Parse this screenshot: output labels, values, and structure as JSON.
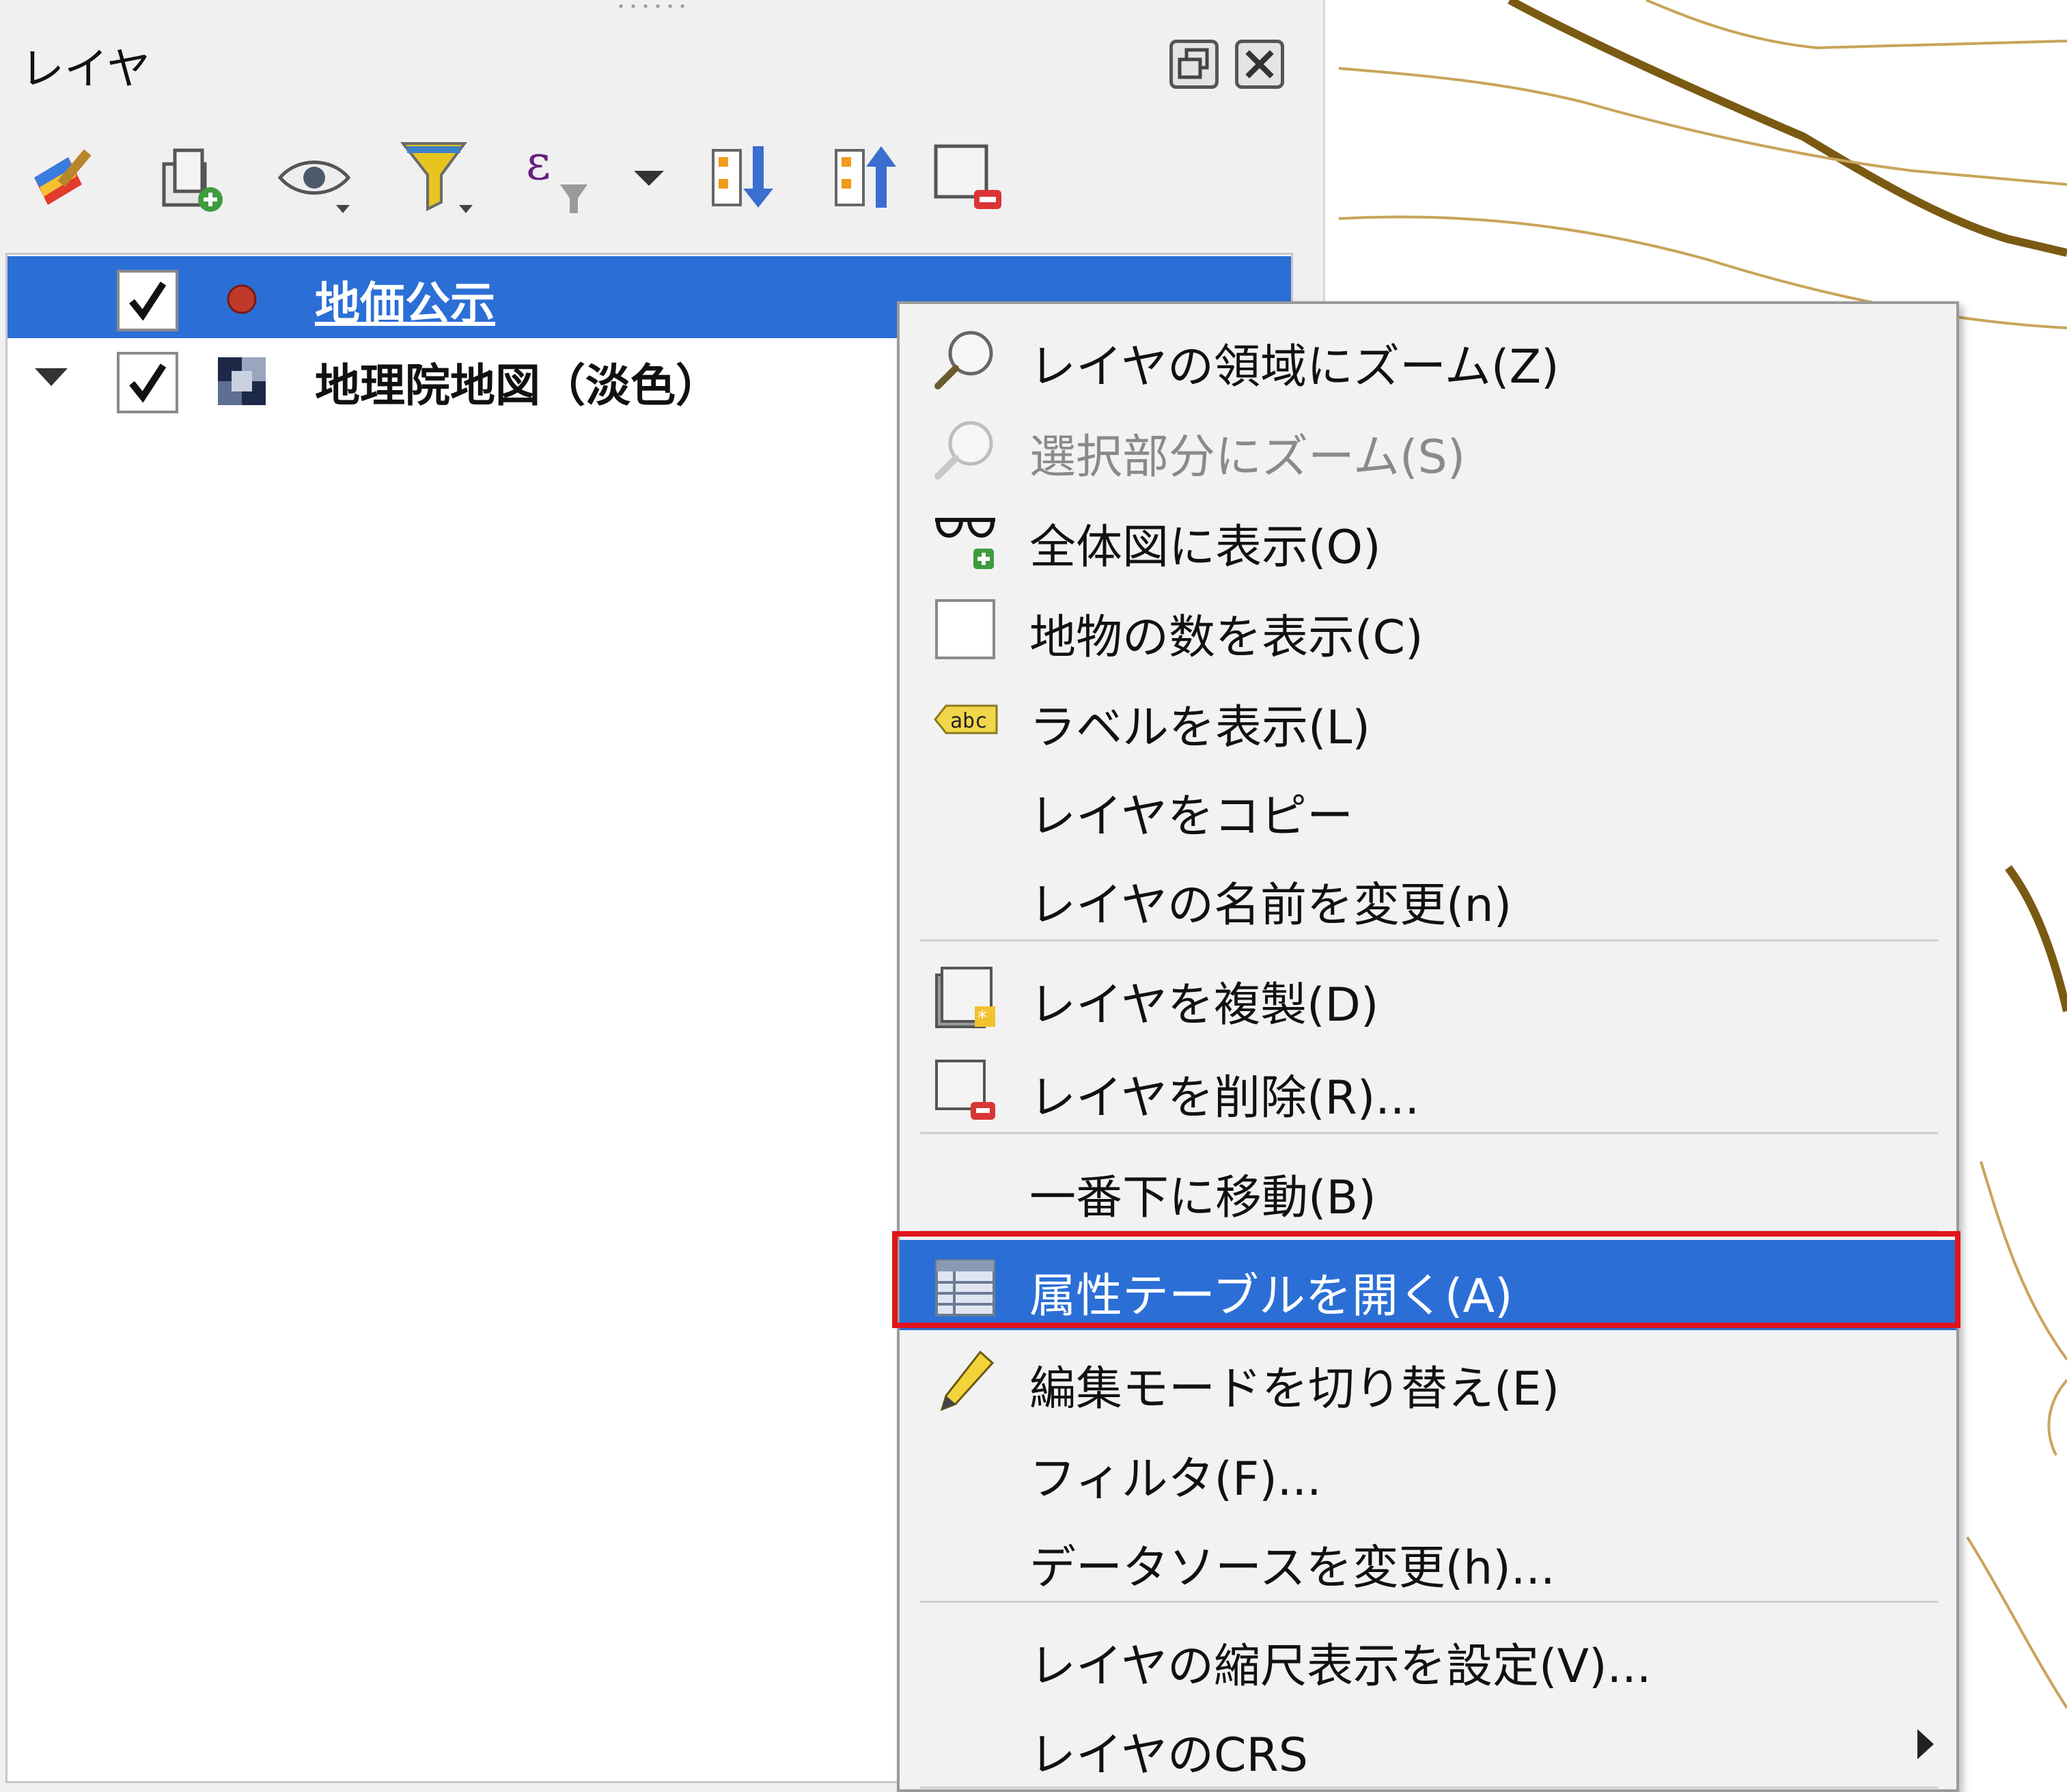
{
  "panel": {
    "title": "レイヤ",
    "toolbar": [
      {
        "icon": "layer-style-brush-icon"
      },
      {
        "icon": "add-group-icon"
      },
      {
        "icon": "visibility-eye-icon"
      },
      {
        "icon": "filter-funnel-icon"
      },
      {
        "icon": "expression-filter-icon"
      },
      {
        "icon": "expand-all-icon"
      },
      {
        "icon": "collapse-all-icon"
      },
      {
        "icon": "remove-layer-icon"
      }
    ]
  },
  "tree": {
    "layers": [
      {
        "name": "地価公示",
        "checked": true,
        "selected": true,
        "icon": "point-layer-icon"
      },
      {
        "name": "地理院地図（淡色）",
        "checked": true,
        "selected": false,
        "icon": "raster-layer-icon"
      }
    ]
  },
  "menu": {
    "items": [
      {
        "label": "レイヤの領域にズーム(Z)",
        "icon": "zoom-layer-icon"
      },
      {
        "label": "選択部分にズーム(S)",
        "icon": "zoom-selection-icon",
        "disabled": true
      },
      {
        "label": "全体図に表示(O)",
        "icon": "overview-glasses-icon"
      },
      {
        "label": "地物の数を表示(C)",
        "icon": "checkbox-icon"
      },
      {
        "label": "ラベルを表示(L)",
        "icon": "label-abc-icon",
        "icon_text": "abc"
      },
      {
        "label": "レイヤをコピー"
      },
      {
        "label": "レイヤの名前を変更(n)"
      },
      {
        "label": "レイヤを複製(D)",
        "icon": "duplicate-layer-icon"
      },
      {
        "label": "レイヤを削除(R)...",
        "icon": "remove-layer-icon"
      },
      {
        "label": "一番下に移動(B)"
      },
      {
        "label": "属性テーブルを開く(A)",
        "icon": "attribute-table-icon",
        "highlighted": true
      },
      {
        "label": "編集モードを切り替え(E)",
        "icon": "edit-pencil-icon"
      },
      {
        "label": "フィルタ(F)..."
      },
      {
        "label": "データソースを変更(h)..."
      },
      {
        "label": "レイヤの縮尺表示を設定(V)..."
      },
      {
        "label": "レイヤのCRS",
        "submenu": true
      }
    ]
  },
  "colors": {
    "selection": "#2b6fd6",
    "highlight_frame": "#e0151b",
    "contour": "#a07a1c"
  }
}
